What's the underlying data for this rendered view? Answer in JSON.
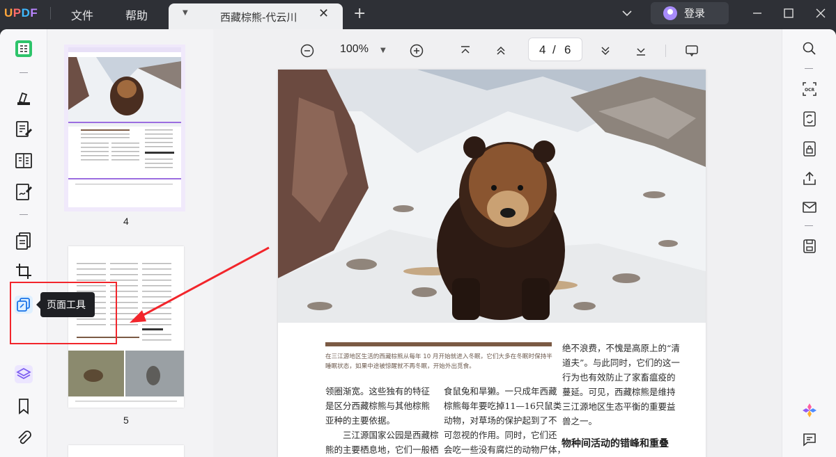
{
  "app": {
    "logo_text": "UPDF"
  },
  "menu": {
    "file": "文件",
    "help": "帮助"
  },
  "tab": {
    "title": "西藏棕熊-代云川",
    "close": "✕",
    "new_tab": "+"
  },
  "account": {
    "login_label": "登录"
  },
  "toolbar": {
    "zoom_value": "100%",
    "current_page": "4",
    "page_separator": "/",
    "total_pages": "6"
  },
  "thumbnails": [
    {
      "page_label": "4",
      "selected": true
    },
    {
      "page_label": "5",
      "selected": false
    }
  ],
  "tooltip": {
    "page_tools": "页面工具"
  },
  "document": {
    "caption": "在三江源地区生活的西藏棕熊从每年 10 月开始就进入冬眠，它们大多在冬眠时保持半睡眠状态，如果中途被惊醒就不再冬眠，开始外出觅食。",
    "col1": [
      "领圈渐宽。这些独有的特征",
      "是区分西藏棕熊与其他棕熊",
      "亚种的主要依据。",
      "　　三江源国家公园是西藏棕",
      "熊的主要栖息地，它们一般栖"
    ],
    "col2": [
      "食鼠兔和旱獭。一只成年西藏",
      "棕熊每年要吃掉11—16只鼠类",
      "动物，对草场的保护起到了不",
      "可忽视的作用。同时，它们还",
      "会吃一些没有腐烂的动物尸体，"
    ],
    "col3": [
      "绝不浪费，不愧是高原上的“清",
      "道夫”。与此同时，它们的这一",
      "行为也有效防止了家畜瘟疫的",
      "蔓延。可见，西藏棕熊是维持",
      "三江源地区生态平衡的重要益",
      "兽之一。"
    ],
    "heading": "物种间活动的错峰和重叠"
  },
  "colors": {
    "accent": "#6b5bd6",
    "annotation_red": "#f2252b",
    "rule_brown": "#7b5a44"
  }
}
